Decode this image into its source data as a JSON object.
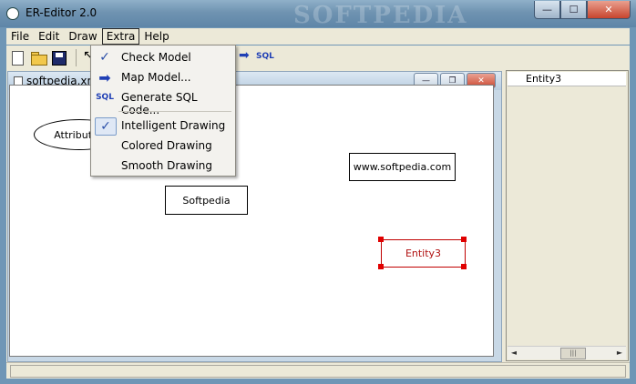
{
  "window": {
    "title": "ER-Editor 2.0",
    "watermark": "SOFTPEDIA",
    "controls": {
      "minimize": "—",
      "maximize": "☐",
      "close": "✕"
    }
  },
  "menubar": [
    "File",
    "Edit",
    "Draw",
    "Extra",
    "Help"
  ],
  "toolbar": {
    "pointer_glyph": "↖",
    "map_glyph": "➡",
    "sql_label": "SQL"
  },
  "extra_menu": {
    "items": [
      {
        "label": "Check Model",
        "icon": "check-icon",
        "glyph": "✓",
        "highlighted": false
      },
      {
        "label": "Map Model...",
        "icon": "arrow-right-icon",
        "glyph": "➡",
        "highlighted": false
      },
      {
        "label": "Generate SQL Code...",
        "icon": "sql-icon",
        "glyph": "SQL",
        "highlighted": false
      },
      {
        "label": "Intelligent Drawing",
        "icon": "check-icon",
        "glyph": "✓",
        "checked": true
      },
      {
        "label": "Colored Drawing",
        "checked": false
      },
      {
        "label": "Smooth Drawing",
        "checked": false
      }
    ]
  },
  "document": {
    "title": "softpedia.xml",
    "controls": {
      "minimize": "—",
      "restore": "❐",
      "close": "✕"
    }
  },
  "diagram": {
    "attribute": "Attribute1",
    "entity_softpedia": "Softpedia",
    "entity_www": "www.softpedia.com",
    "entity_selected": "Entity3"
  },
  "right_panel": {
    "items": [
      "Entity3"
    ],
    "scroll_left": "◄",
    "scroll_right": "►",
    "scroll_thumb": "|||"
  },
  "colors": {
    "selection": "#e00000",
    "menu_accent": "#1f3fb5"
  }
}
